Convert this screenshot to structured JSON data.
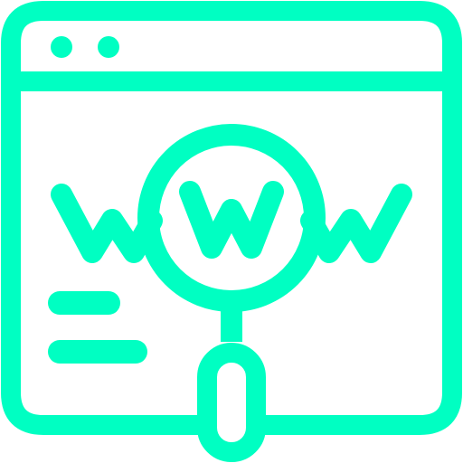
{
  "icon": {
    "name": "website-search-icon",
    "color": "#00ffc2",
    "parts": [
      "browser-window-icon",
      "magnifier-icon",
      "www-text-icon"
    ]
  }
}
